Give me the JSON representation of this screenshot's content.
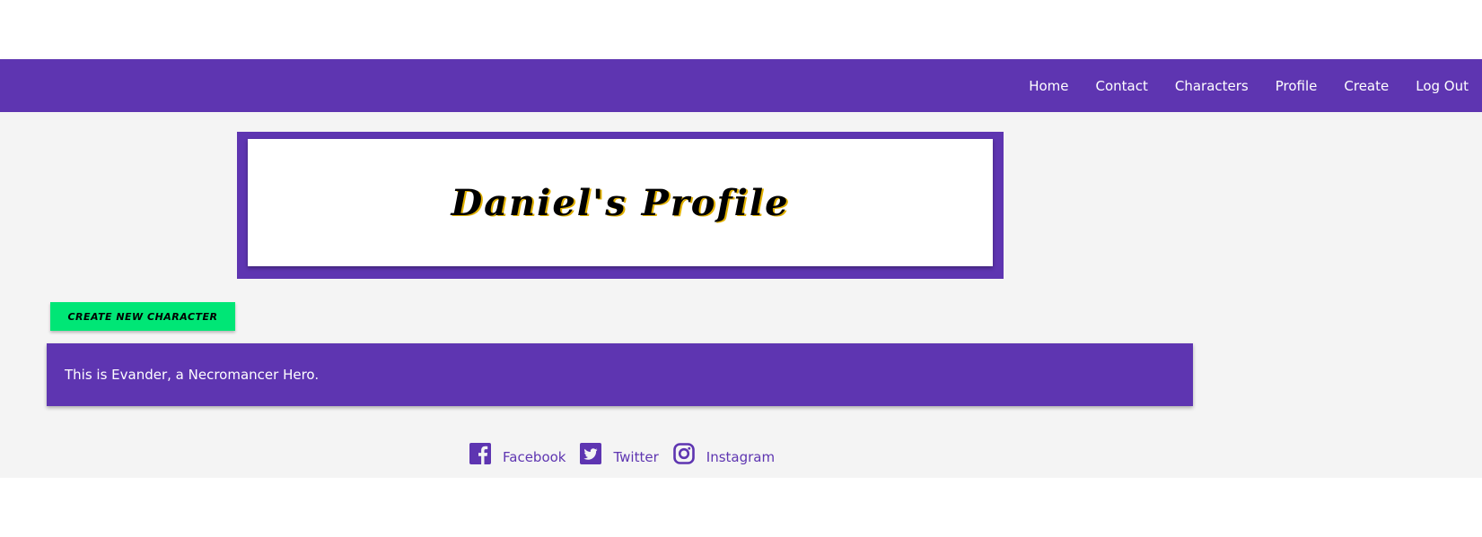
{
  "nav": {
    "items": [
      {
        "label": "Home"
      },
      {
        "label": "Contact"
      },
      {
        "label": "Characters"
      },
      {
        "label": "Profile"
      },
      {
        "label": "Create"
      },
      {
        "label": "Log Out"
      }
    ]
  },
  "header": {
    "title": "Daniel's Profile"
  },
  "actions": {
    "create_label": "create new character"
  },
  "characters": [
    {
      "description": "This is Evander, a Necromancer Hero."
    }
  ],
  "footer": {
    "social": [
      {
        "label": "Facebook",
        "icon": "facebook-icon"
      },
      {
        "label": "Twitter",
        "icon": "twitter-icon"
      },
      {
        "label": "Instagram",
        "icon": "instagram-icon"
      }
    ]
  },
  "colors": {
    "primary": "#5e35b1",
    "accent": "#00e676",
    "background": "#f4f4f4"
  }
}
